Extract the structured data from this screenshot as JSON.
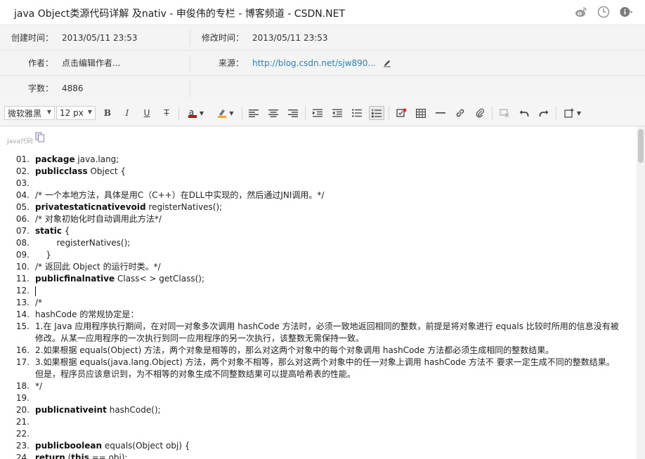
{
  "window": {
    "title": "java Object类源代码详解 及nativ - 申俊伟的专栏 - 博客频道 - CSDN.NET"
  },
  "title_icons": [
    "weibo-icon",
    "clock-icon",
    "info-icon"
  ],
  "meta": {
    "created_label": "创建时间：",
    "created_value": "2013/05/11 23:53",
    "modified_label": "修改时间：",
    "modified_value": "2013/05/11 23:53",
    "author_label": "作者：",
    "author_value": "点击编辑作者...",
    "source_label": "来源：",
    "source_value": "http://blog.csdn.net/sjw890...",
    "words_label": "字数：",
    "words_value": "4886"
  },
  "toolbar": {
    "font_family": "微软雅黑",
    "font_size": "12 px",
    "bold": "B",
    "italic": "I",
    "underline": "U",
    "strike": "T",
    "font_color": "a"
  },
  "colors": {
    "font_color": "#d0021b",
    "highlight": "#f5a623",
    "link": "#2f7fc1",
    "checkbox_dot": "#e02020"
  },
  "editor": {
    "code_label": "Java代码",
    "lines": [
      {
        "n": "01.",
        "t": "package java.lang;"
      },
      {
        "n": "02.",
        "t": "publicclass Object {"
      },
      {
        "n": "03.",
        "t": ""
      },
      {
        "n": "04.",
        "t": "/* 一个本地方法，具体是用C（C++）在DLL中实现的，然后通过JNI调用。*/"
      },
      {
        "n": "05.",
        "t": "privatestaticnativevoid registerNatives();"
      },
      {
        "n": "06.",
        "t": "/* 对象初始化时自动调用此方法*/"
      },
      {
        "n": "07.",
        "t": "static {"
      },
      {
        "n": "08.",
        "t": "        registerNatives();"
      },
      {
        "n": "09.",
        "t": "    }"
      },
      {
        "n": "10.",
        "t": "/* 返回此 Object 的运行时类。*/"
      },
      {
        "n": "11.",
        "t": "publicfinalnative Class< > getClass();"
      },
      {
        "n": "12.",
        "t": ""
      },
      {
        "n": "13.",
        "t": "/*"
      },
      {
        "n": "14.",
        "t": "hashCode 的常规协定是："
      },
      {
        "n": "15.",
        "t": "1.在 Java 应用程序执行期间，在对同一对象多次调用 hashCode 方法时，必须一致地返回相同的整数，前提是将对象进行 equals 比较时所用的信息没有被修改。从某一应用程序的一次执行到同一应用程序的另一次执行，该整数无需保持一致。"
      },
      {
        "n": "16.",
        "t": "2.如果根据 equals(Object) 方法，两个对象是相等的，那么对这两个对象中的每个对象调用 hashCode 方法都必须生成相同的整数结果。"
      },
      {
        "n": "17.",
        "t": "3.如果根据 equals(java.lang.Object) 方法，两个对象不相等，那么对这两个对象中的任一对象上调用 hashCode 方法不 要求一定生成不同的整数结果。但是，程序员应该意识到，为不相等的对象生成不同整数结果可以提高哈希表的性能。"
      },
      {
        "n": "18.",
        "t": "*/"
      },
      {
        "n": "19.",
        "t": ""
      },
      {
        "n": "20.",
        "t": "publicnativeint hashCode();"
      },
      {
        "n": "21.",
        "t": ""
      },
      {
        "n": "22.",
        "t": ""
      },
      {
        "n": "23.",
        "t": "publicboolean equals(Object obj) {"
      },
      {
        "n": "24.",
        "t": "return (this == obj);"
      }
    ]
  }
}
